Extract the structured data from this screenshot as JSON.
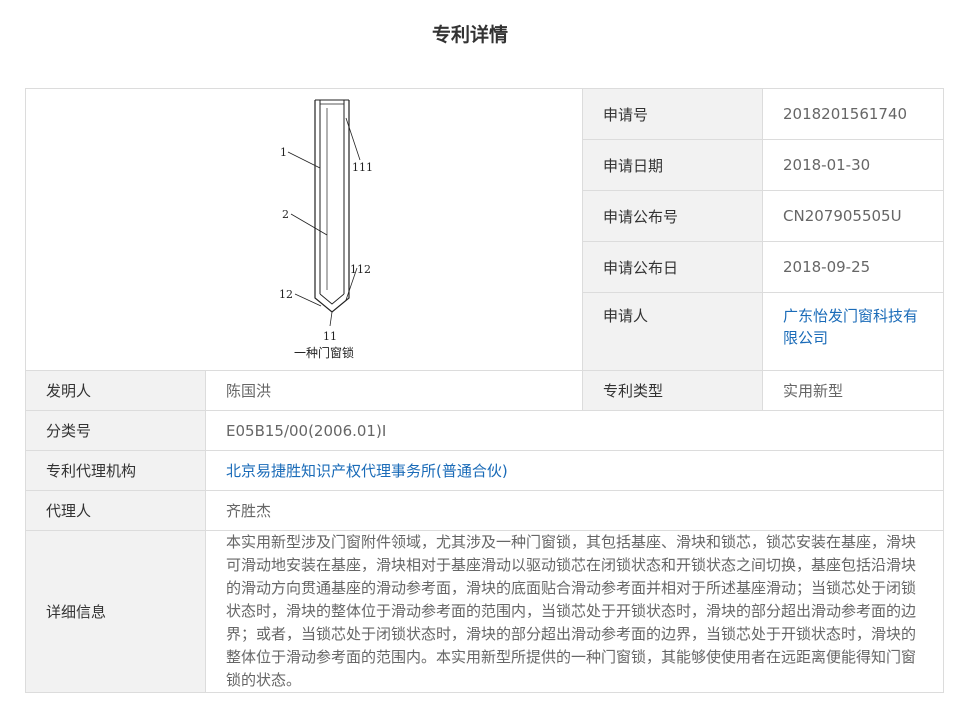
{
  "page": {
    "title": "专利详情"
  },
  "figure": {
    "caption": "一种门窗锁",
    "callouts": [
      "1",
      "2",
      "12",
      "11",
      "111",
      "112"
    ]
  },
  "fields": {
    "application_no": {
      "label": "申请号",
      "value": "2018201561740"
    },
    "application_date": {
      "label": "申请日期",
      "value": "2018-01-30"
    },
    "publication_no": {
      "label": "申请公布号",
      "value": "CN207905505U"
    },
    "publication_date": {
      "label": "申请公布日",
      "value": "2018-09-25"
    },
    "applicant": {
      "label": "申请人",
      "value": "广东怡发门窗科技有限公司"
    },
    "inventor": {
      "label": "发明人",
      "value": "陈国洪"
    },
    "patent_type": {
      "label": "专利类型",
      "value": "实用新型"
    },
    "classification": {
      "label": "分类号",
      "value": "E05B15/00(2006.01)I"
    },
    "agency": {
      "label": "专利代理机构",
      "value": "北京易捷胜知识产权代理事务所(普通合伙)"
    },
    "agent": {
      "label": "代理人",
      "value": "齐胜杰"
    },
    "details": {
      "label": "详细信息",
      "value": "本实用新型涉及门窗附件领域，尤其涉及一种门窗锁，其包括基座、滑块和锁芯，锁芯安装在基座，滑块可滑动地安装在基座，滑块相对于基座滑动以驱动锁芯在闭锁状态和开锁状态之间切换，基座包括沿滑块的滑动方向贯通基座的滑动参考面，滑块的底面贴合滑动参考面并相对于所述基座滑动；当锁芯处于闭锁状态时，滑块的整体位于滑动参考面的范围内，当锁芯处于开锁状态时，滑块的部分超出滑动参考面的边界；或者，当锁芯处于闭锁状态时，滑块的部分超出滑动参考面的边界，当锁芯处于开锁状态时，滑块的整体位于滑动参考面的范围内。本实用新型所提供的一种门窗锁，其能够使使用者在远距离便能得知门窗锁的状态。"
    }
  },
  "colors": {
    "link": "#1a6bb8",
    "label_bg": "#f2f2f2",
    "border": "#dcdcdc"
  }
}
